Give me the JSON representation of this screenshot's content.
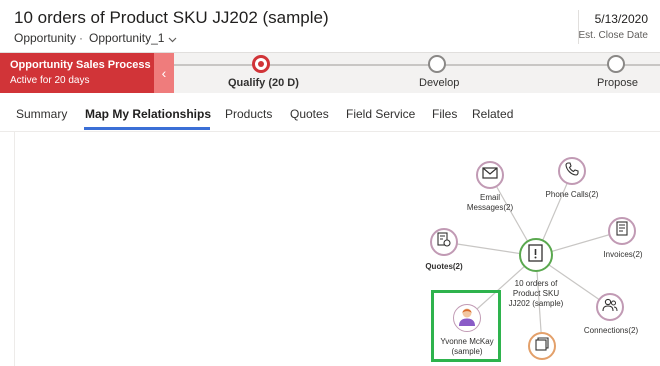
{
  "header": {
    "title": "10 orders of Product SKU JJ202 (sample)",
    "entity": "Opportunity",
    "form": "Opportunity_1",
    "close_date": "5/13/2020",
    "close_date_label": "Est. Close Date"
  },
  "bpf": {
    "process_name": "Opportunity Sales Process",
    "process_age": "Active for 20 days",
    "stages": [
      {
        "label": "Qualify  (20 D)",
        "active": true
      },
      {
        "label": "Develop",
        "active": false
      },
      {
        "label": "Propose",
        "active": false
      }
    ]
  },
  "tabs": [
    "Summary",
    "Map My Relationships",
    "Products",
    "Quotes",
    "Field Service",
    "Files",
    "Related"
  ],
  "active_tab": "Map My Relationships",
  "relationship_map": {
    "center": {
      "label_lines": [
        "10 orders of",
        "Product SKU",
        "JJ202 (sample)"
      ],
      "icon": "document-alert-icon"
    },
    "nodes": [
      {
        "id": "email",
        "label_lines": [
          "Email",
          "Messages(2)"
        ],
        "icon": "envelope-icon"
      },
      {
        "id": "phone",
        "label_lines": [
          "Phone Calls(2)"
        ],
        "icon": "phone-icon"
      },
      {
        "id": "invoices",
        "label_lines": [
          "Invoices(2)"
        ],
        "icon": "invoice-icon"
      },
      {
        "id": "connections",
        "label_lines": [
          "Connections(2)"
        ],
        "icon": "people-icon"
      },
      {
        "id": "quotes",
        "label_lines": [
          "Quotes(2)"
        ],
        "icon": "quote-icon"
      },
      {
        "id": "contact",
        "label_lines": [
          "Yvonne McKay",
          "(sample)"
        ],
        "icon": "person-avatar-icon"
      },
      {
        "id": "other",
        "label_lines": [],
        "icon": "folder-icon"
      }
    ],
    "colors": {
      "accent": "#d13438",
      "link": "#c8c6c4",
      "node_border": "#c19ab4",
      "center_border": "#5aa84f",
      "highlight": "#2eb34d"
    }
  }
}
